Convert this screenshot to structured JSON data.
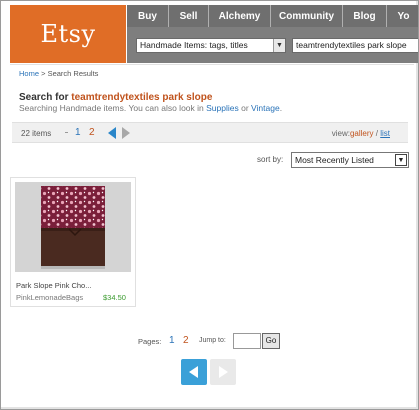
{
  "header": {
    "logo_text": "Etsy",
    "nav": [
      "Buy",
      "Sell",
      "Alchemy",
      "Community",
      "Blog",
      "Yo"
    ],
    "search_scope": "Handmade Items: tags, titles",
    "search_query": "teamtrendytextiles park slope"
  },
  "breadcrumb": {
    "home": "Home",
    "separator": " > ",
    "current": "Search Results"
  },
  "results": {
    "title_prefix": "Search for ",
    "term": "teamtrendytextiles park slope",
    "sub_prefix": "Searching Handmade items. You can also look in ",
    "link_supplies": "Supplies",
    "sub_or": " or ",
    "link_vintage": "Vintage",
    "sub_suffix": "."
  },
  "pager_top": {
    "count": "22 items",
    "page1": "1",
    "page2": "2",
    "view_label": "view:",
    "view_gallery": "gallery",
    "view_sep": " / ",
    "view_list": "list"
  },
  "sort": {
    "label": "sort by:",
    "value": "Most Recently Listed"
  },
  "items": [
    {
      "title": "Park Slope Pink Cho...",
      "seller": "PinkLemonadeBags",
      "price": "$34.50"
    }
  ],
  "pager_bottom": {
    "pages_label": "Pages:",
    "page1": "1",
    "page2": "2",
    "jump_label": "Jump to:",
    "go": "Go"
  },
  "colors": {
    "brand_orange": "#e06d26",
    "link_blue": "#2a73b8",
    "active_orange": "#c0531d",
    "price_green": "#3a9b2e"
  }
}
